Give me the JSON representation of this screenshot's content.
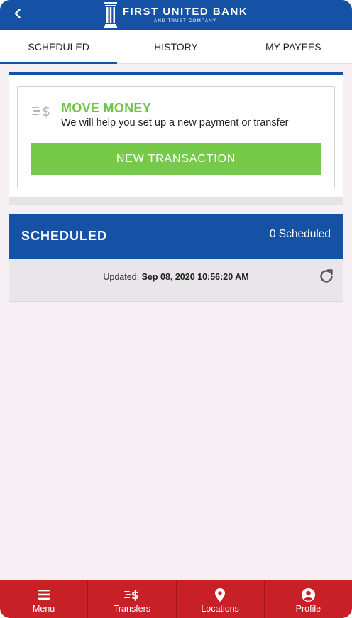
{
  "header": {
    "back_icon": "chevron-left-icon",
    "logo_icon": "bank-pillar-logo",
    "bank_name": "FIRST UNITED BANK",
    "bank_subtitle": "AND TRUST COMPANY"
  },
  "tabs": [
    {
      "label": "SCHEDULED",
      "active": true
    },
    {
      "label": "HISTORY",
      "active": false
    },
    {
      "label": "MY PAYEES",
      "active": false
    }
  ],
  "move_money": {
    "icon": "dollar-transfer-icon",
    "title": "MOVE MONEY",
    "description": "We will help you set up a new payment or transfer",
    "button_label": "NEW TRANSACTION"
  },
  "scheduled": {
    "title": "SCHEDULED",
    "count_label": "0 Scheduled",
    "updated_label": "Updated:",
    "updated_value": "Sep 08, 2020 10:56:20 AM",
    "refresh_icon": "refresh-icon"
  },
  "bottom_nav": [
    {
      "label": "Menu",
      "icon": "hamburger-menu-icon"
    },
    {
      "label": "Transfers",
      "icon": "dollar-transfer-icon"
    },
    {
      "label": "Locations",
      "icon": "map-pin-icon"
    },
    {
      "label": "Profile",
      "icon": "user-circle-icon"
    }
  ],
  "colors": {
    "brand_blue": "#1552a5",
    "accent_green": "#77c94a",
    "nav_red": "#c82027",
    "background": "#f6f0f4"
  }
}
